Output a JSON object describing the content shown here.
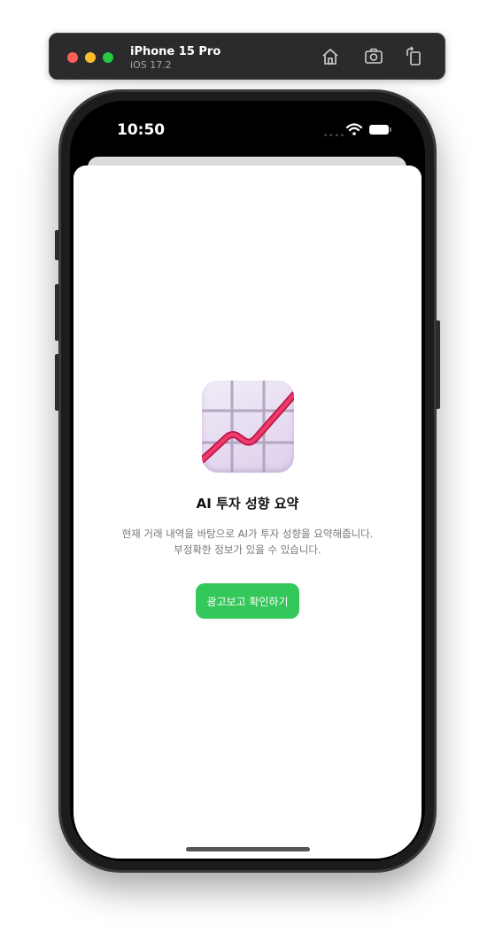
{
  "simulator": {
    "device_name": "iPhone 15 Pro",
    "os_version": "iOS 17.2",
    "toolbar_icons": [
      "home-icon",
      "screenshot-icon",
      "rotate-icon"
    ]
  },
  "status_bar": {
    "time": "10:50"
  },
  "card": {
    "icon": "chart-increasing-icon",
    "title": "AI 투자 성향 요약",
    "description_line1": "현재 거래 내역을 바탕으로 AI가 투자 성향을 요약해줍니다.",
    "description_line2": "부정확한 정보가 있을 수 있습니다.",
    "button_label": "광고보고 확인하기"
  },
  "colors": {
    "accent": "#34c759",
    "sim_bar": "#2b2b2d"
  }
}
